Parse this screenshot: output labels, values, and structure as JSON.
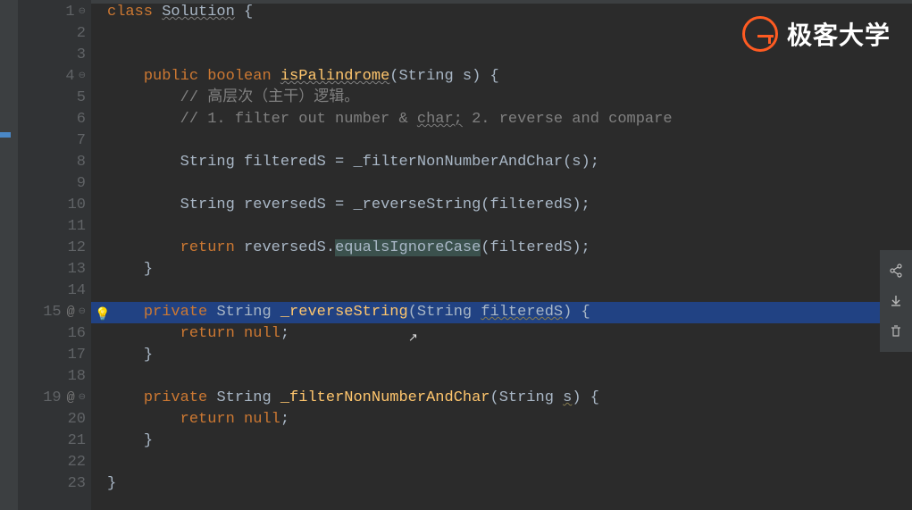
{
  "brand": {
    "text": "极客大学"
  },
  "gutter": [
    {
      "n": "1",
      "ann": "",
      "fold": "⊖"
    },
    {
      "n": "2",
      "ann": "",
      "fold": ""
    },
    {
      "n": "3",
      "ann": "",
      "fold": ""
    },
    {
      "n": "4",
      "ann": "",
      "fold": "⊖"
    },
    {
      "n": "5",
      "ann": "",
      "fold": ""
    },
    {
      "n": "6",
      "ann": "",
      "fold": ""
    },
    {
      "n": "7",
      "ann": "",
      "fold": ""
    },
    {
      "n": "8",
      "ann": "",
      "fold": ""
    },
    {
      "n": "9",
      "ann": "",
      "fold": ""
    },
    {
      "n": "10",
      "ann": "",
      "fold": ""
    },
    {
      "n": "11",
      "ann": "",
      "fold": ""
    },
    {
      "n": "12",
      "ann": "",
      "fold": ""
    },
    {
      "n": "13",
      "ann": "",
      "fold": ""
    },
    {
      "n": "14",
      "ann": "",
      "fold": ""
    },
    {
      "n": "15",
      "ann": "@",
      "fold": "⊖"
    },
    {
      "n": "16",
      "ann": "",
      "fold": ""
    },
    {
      "n": "17",
      "ann": "",
      "fold": ""
    },
    {
      "n": "18",
      "ann": "",
      "fold": ""
    },
    {
      "n": "19",
      "ann": "@",
      "fold": "⊖"
    },
    {
      "n": "20",
      "ann": "",
      "fold": ""
    },
    {
      "n": "21",
      "ann": "",
      "fold": ""
    },
    {
      "n": "22",
      "ann": "",
      "fold": ""
    },
    {
      "n": "23",
      "ann": "",
      "fold": ""
    }
  ],
  "code": {
    "l1": {
      "kw1": "class ",
      "cls": "Solution",
      "rest": " {"
    },
    "l4": {
      "kw1": "public ",
      "kw2": "boolean ",
      "m": "isPalindrome",
      "sig": "(String s) {"
    },
    "l5": {
      "c": "// 高层次（主干）逻辑。"
    },
    "l6": {
      "c1": "// 1. filter out number & ",
      "c2": "char;",
      "c3": " 2. reverse and compare"
    },
    "l8": {
      "t": "String filteredS = ",
      "m": "_filterNonNumberAndChar",
      "r": "(s);"
    },
    "l10": {
      "t": "String reversedS = ",
      "m": "_reverseString",
      "r": "(filteredS);"
    },
    "l12": {
      "kw": "return ",
      "a": "reversedS.",
      "hl": "equalsIgnoreCase",
      "r": "(filteredS);"
    },
    "l13": {
      "b": "}"
    },
    "l15": {
      "kw1": "private ",
      "t": "String ",
      "m": "_reverseString",
      "p1": "(String ",
      "p2": "filteredS",
      "p3": ") {"
    },
    "l16": {
      "kw": "return ",
      "n": "null",
      "s": ";"
    },
    "l17": {
      "b": "}"
    },
    "l19": {
      "kw1": "private ",
      "t": "String ",
      "m": "_filterNonNumberAndChar",
      "p1": "(String ",
      "p2": "s",
      "p3": ") {"
    },
    "l20": {
      "kw": "return ",
      "n": "null",
      "s": ";"
    },
    "l21": {
      "b": "}"
    },
    "l23": {
      "b": "}"
    }
  },
  "indent": {
    "i1": "",
    "i2": "    ",
    "i3": "        ",
    "i4": "            "
  }
}
